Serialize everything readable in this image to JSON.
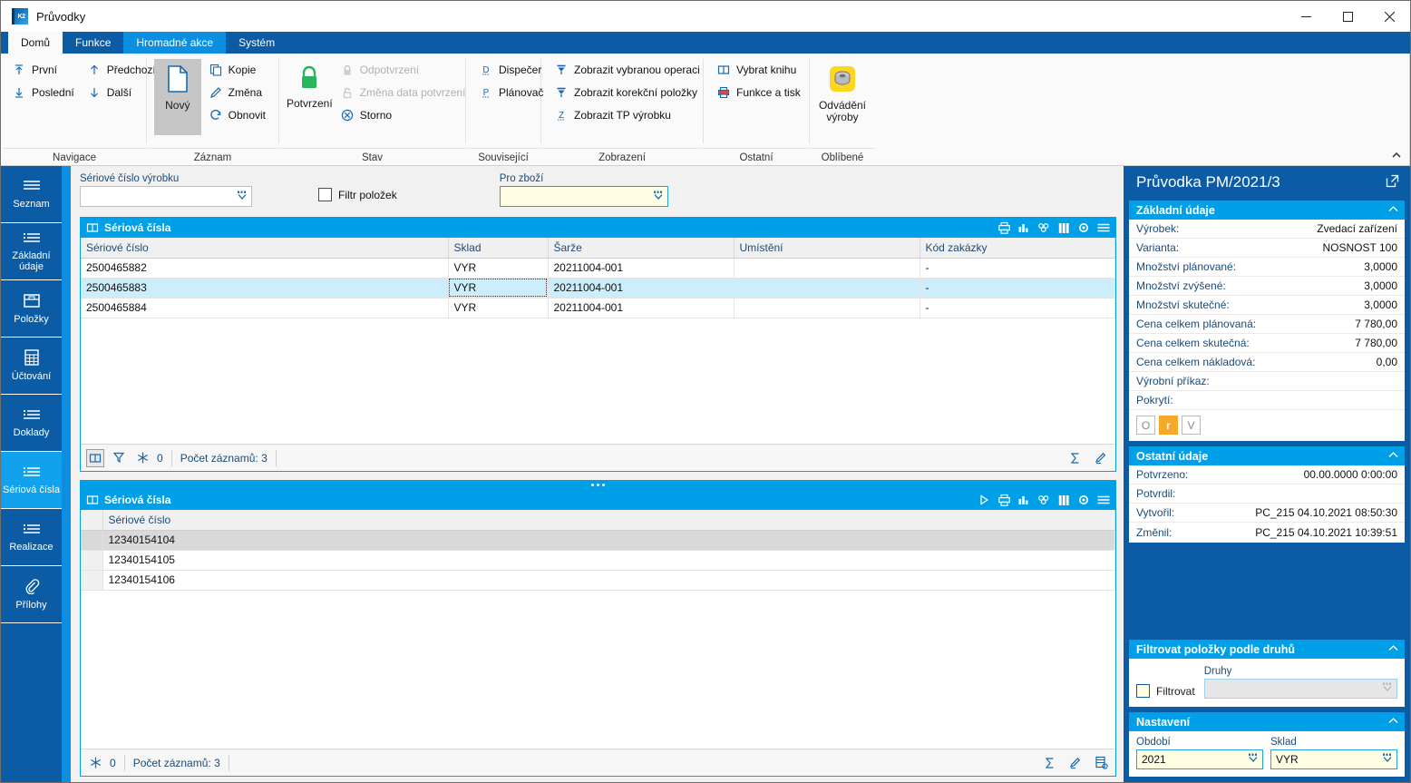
{
  "window": {
    "title": "Průvodky",
    "icon": "k2-app-icon",
    "controls": {
      "minimize": "—",
      "maximize": "☐",
      "close": "✕"
    }
  },
  "ribbon": {
    "tabs": [
      {
        "label": "Domů",
        "state": "active"
      },
      {
        "label": "Funkce",
        "state": "normal"
      },
      {
        "label": "Hromadné akce",
        "state": "hover"
      },
      {
        "label": "Systém",
        "state": "normal"
      }
    ],
    "groups": [
      {
        "label": "Navigace",
        "columns": [
          {
            "items": [
              {
                "label": "První",
                "icon": "arrow-up-bar-icon",
                "disabled": false
              },
              {
                "label": "Poslední",
                "icon": "arrow-down-bar-icon",
                "disabled": false
              }
            ]
          },
          {
            "items": [
              {
                "label": "Předchozí",
                "icon": "arrow-up-icon",
                "disabled": false
              },
              {
                "label": "Další",
                "icon": "arrow-down-icon",
                "disabled": false
              }
            ]
          }
        ]
      },
      {
        "label": "Záznam",
        "big": {
          "label": "Nový",
          "icon": "new-document-icon",
          "selected": true
        },
        "columns": [
          {
            "items": [
              {
                "label": "Kopie",
                "icon": "copy-icon",
                "disabled": false
              },
              {
                "label": "Změna",
                "icon": "pencil-icon",
                "disabled": false
              },
              {
                "label": "Obnovit",
                "icon": "refresh-icon",
                "disabled": false
              }
            ]
          }
        ]
      },
      {
        "label": "Stav",
        "big": {
          "label": "Potvrzení",
          "icon": "green-lock-icon",
          "selected": false
        },
        "columns": [
          {
            "items": [
              {
                "label": "Odpotvrzení",
                "icon": "lock-gray-icon",
                "disabled": true
              },
              {
                "label": "Změna data potvrzení",
                "icon": "lock-open-gray-icon",
                "disabled": true
              },
              {
                "label": "Storno",
                "icon": "cancel-circle-icon",
                "disabled": false
              }
            ]
          }
        ]
      },
      {
        "label": "Související",
        "columns": [
          {
            "items": [
              {
                "label": "Dispečer",
                "icon": "letter-d-icon",
                "disabled": false
              },
              {
                "label": "Plánovač",
                "icon": "letter-p-icon",
                "disabled": false
              }
            ]
          }
        ]
      },
      {
        "label": "Zobrazení",
        "columns": [
          {
            "items": [
              {
                "label": "Zobrazit vybranou operaci",
                "icon": "filter-funnel-icon",
                "disabled": false
              },
              {
                "label": "Zobrazit korekční položky",
                "icon": "filter-funnel-icon",
                "disabled": false
              },
              {
                "label": "Zobrazit TP výrobku",
                "icon": "letter-z-icon",
                "disabled": false
              }
            ]
          }
        ]
      },
      {
        "label": "Ostatní",
        "columns": [
          {
            "items": [
              {
                "label": "Vybrat knihu",
                "icon": "book-icon",
                "disabled": false
              },
              {
                "label": "Funkce a tisk",
                "icon": "printer-icon",
                "disabled": false
              }
            ]
          }
        ]
      },
      {
        "label": "Oblíbené",
        "big": {
          "label": "Odvádění\nvýroby",
          "icon": "yellow-nut-icon",
          "selected": false
        },
        "columns": []
      }
    ],
    "collapse_icon": "chevron-up-icon"
  },
  "sidebar": {
    "items": [
      {
        "label": "Seznam",
        "icon": "list-lines-icon",
        "active": false
      },
      {
        "label": "Základní údaje",
        "icon": "bullet-list-icon",
        "active": false
      },
      {
        "label": "Položky",
        "icon": "box-icon",
        "active": false
      },
      {
        "label": "Účtování",
        "icon": "calculator-icon",
        "active": false
      },
      {
        "label": "Doklady",
        "icon": "bullet-list-icon",
        "active": false
      },
      {
        "label": "Sériová čísla",
        "icon": "bullet-list-icon",
        "active": true
      },
      {
        "label": "Realizace",
        "icon": "bullet-list-icon",
        "active": false
      },
      {
        "label": "Přílohy",
        "icon": "paperclip-icon",
        "active": false
      }
    ]
  },
  "filterbar": {
    "serial_label": "Sériové číslo výrobku",
    "serial_value": "",
    "checkbox_label": "Filtr položek",
    "checkbox_checked": false,
    "goods_label": "Pro zboží",
    "goods_value": "",
    "lookup_icon": "lookup-dropdown-icon"
  },
  "grid_top": {
    "title": "Sériová čísla",
    "title_icon": "book-icon",
    "header_icons": [
      "printer-icon",
      "bar-chart-icon",
      "pivot-icon",
      "columns-icon",
      "gear-icon",
      "menu-icon"
    ],
    "columns": [
      "Sériové číslo",
      "Sklad",
      "Šarže",
      "Umístění",
      "Kód zakázky"
    ],
    "rows": [
      {
        "cells": [
          "2500465882",
          "VYR",
          "20211004-001",
          "",
          "-"
        ],
        "selected": false
      },
      {
        "cells": [
          "2500465883",
          "VYR",
          "20211004-001",
          "",
          "-"
        ],
        "selected": true
      },
      {
        "cells": [
          "2500465884",
          "VYR",
          "20211004-001",
          "",
          "-"
        ],
        "selected": false
      }
    ],
    "status": {
      "icons": [
        "book-view-icon",
        "filter-icon",
        "snowflake-icon"
      ],
      "frozen_count": "0",
      "count_label": "Počet záznamů: 3",
      "right_icons": [
        "sigma-icon",
        "pencil-icon"
      ]
    }
  },
  "grid_bottom": {
    "title": "Sériová čísla",
    "title_icon": "book-icon",
    "header_icons": [
      "play-icon",
      "printer-icon",
      "bar-chart-icon",
      "pivot-icon",
      "columns-icon",
      "gear-icon",
      "menu-icon"
    ],
    "columns": [
      "Sériové číslo"
    ],
    "rows": [
      {
        "cells": [
          "12340154104"
        ],
        "current": true
      },
      {
        "cells": [
          "12340154105"
        ],
        "current": false
      },
      {
        "cells": [
          "12340154106"
        ],
        "current": false
      }
    ],
    "status": {
      "icons": [
        "snowflake-icon"
      ],
      "frozen_count": "0",
      "count_label": "Počet záznamů: 3",
      "right_icons": [
        "sigma-icon",
        "pencil-icon",
        "grid-doc-icon"
      ]
    }
  },
  "right_panel": {
    "title": "Průvodka PM/2021/3",
    "expand_icon": "open-external-icon",
    "sections": [
      {
        "title": "Základní údaje",
        "collapse_icon": "chevron-up-icon",
        "rows": [
          {
            "key": "Výrobek:",
            "value": "Zvedací zařízení"
          },
          {
            "key": "Varianta:",
            "value": "NOSNOST 100"
          },
          {
            "key": "Množství plánované:",
            "value": "3,0000"
          },
          {
            "key": "Množství zvýšené:",
            "value": "3,0000"
          },
          {
            "key": "Množství skutečné:",
            "value": "3,0000"
          },
          {
            "key": "Cena celkem plánovaná:",
            "value": "7 780,00"
          },
          {
            "key": "Cena celkem skutečná:",
            "value": "7 780,00"
          },
          {
            "key": "Cena celkem nákladová:",
            "value": "0,00"
          },
          {
            "key": "Výrobní příkaz:",
            "value": ""
          },
          {
            "key": "Pokrytí:",
            "value": ""
          }
        ],
        "badges": [
          {
            "label": "O",
            "active": false
          },
          {
            "label": "r",
            "active": true
          },
          {
            "label": "V",
            "active": false
          }
        ],
        "badge_active_color": "#f6a828"
      },
      {
        "title": "Ostatní údaje",
        "collapse_icon": "chevron-up-icon",
        "rows": [
          {
            "key": "Potvrzeno:",
            "value": "00.00.0000 0:00:00"
          },
          {
            "key": "Potvrdil:",
            "value": ""
          },
          {
            "key": "Vytvořil:",
            "value": "PC_215 04.10.2021 08:50:30"
          },
          {
            "key": "Změnil:",
            "value": "PC_215 04.10.2021 10:39:51"
          }
        ]
      }
    ],
    "filter_section": {
      "title": "Filtrovat položky podle druhů",
      "collapse_icon": "chevron-up-icon",
      "checkbox_label": "Filtrovat",
      "checkbox_checked": false,
      "kinds_label": "Druhy",
      "kinds_value": "",
      "lookup_icon": "lookup-dropdown-icon"
    },
    "settings_section": {
      "title": "Nastavení",
      "collapse_icon": "chevron-up-icon",
      "period_label": "Období",
      "period_value": "2021",
      "store_label": "Sklad",
      "store_value": "VYR",
      "lookup_icon": "lookup-dropdown-icon"
    }
  },
  "colors": {
    "ribbon_blue": "#0b5ca5",
    "accent_cyan": "#00a0e9",
    "nav_active": "#12a1ec",
    "selection": "#cceefc",
    "badge_orange": "#f6a828",
    "lock_green": "#2ab45c",
    "nut_yellow": "#ffd100"
  }
}
